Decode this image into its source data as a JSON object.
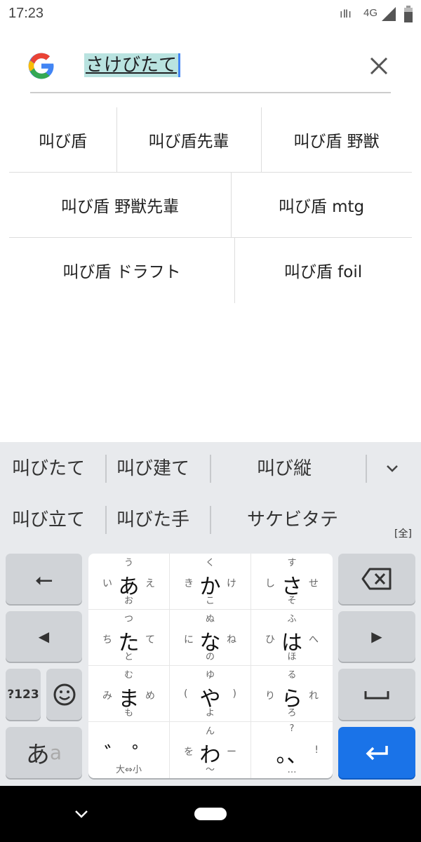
{
  "status_bar": {
    "time": "17:23",
    "network": "4G",
    "icons": [
      "vibrate-icon",
      "signal-icon",
      "battery-icon"
    ]
  },
  "search": {
    "query": "さけびたて",
    "clear_icon": "close-icon",
    "logo": "google-g-logo"
  },
  "suggestions": [
    "叫び盾",
    "叫び盾先輩",
    "叫び盾 野獣",
    "叫び盾 野獣先輩",
    "叫び盾 mtg",
    "叫び盾 ドラフト",
    "叫び盾 foil"
  ],
  "candidates": {
    "row1": [
      "叫びたて",
      "叫び建て",
      "叫び縦"
    ],
    "row2": [
      "叫び立て",
      "叫びた手",
      "サケビタテ"
    ],
    "expand_icon": "chevron-down-icon",
    "mode_badge": "[全]"
  },
  "keyboard": {
    "kana_keys": [
      {
        "m": "あ",
        "t": "う",
        "l": "い",
        "r": "え",
        "b": "お"
      },
      {
        "m": "か",
        "t": "く",
        "l": "き",
        "r": "け",
        "b": "こ"
      },
      {
        "m": "さ",
        "t": "す",
        "l": "し",
        "r": "せ",
        "b": "そ"
      },
      {
        "m": "た",
        "t": "つ",
        "l": "ち",
        "r": "て",
        "b": "と"
      },
      {
        "m": "な",
        "t": "ぬ",
        "l": "に",
        "r": "ね",
        "b": "の"
      },
      {
        "m": "は",
        "t": "ふ",
        "l": "ひ",
        "r": "へ",
        "b": "ほ"
      },
      {
        "m": "ま",
        "t": "む",
        "l": "み",
        "r": "め",
        "b": "も"
      },
      {
        "m": "や",
        "t": "ゆ",
        "l": "(",
        "r": ")",
        "b": "よ"
      },
      {
        "m": "ら",
        "t": "る",
        "l": "り",
        "r": "れ",
        "b": "ろ"
      },
      {
        "m": "゛ ゜",
        "t": "",
        "l": "",
        "r": "",
        "b": "大⇔小"
      },
      {
        "m": "わ",
        "t": "ん",
        "l": "を",
        "r": "ー",
        "b": "〜"
      },
      {
        "m": "。、",
        "t": "?",
        "l": "",
        "r": "!",
        "b": "…"
      }
    ],
    "symbols_label": "?123",
    "mode_label_main": "あ",
    "mode_label_sub": "a",
    "enter_color": "#1a73e8"
  }
}
